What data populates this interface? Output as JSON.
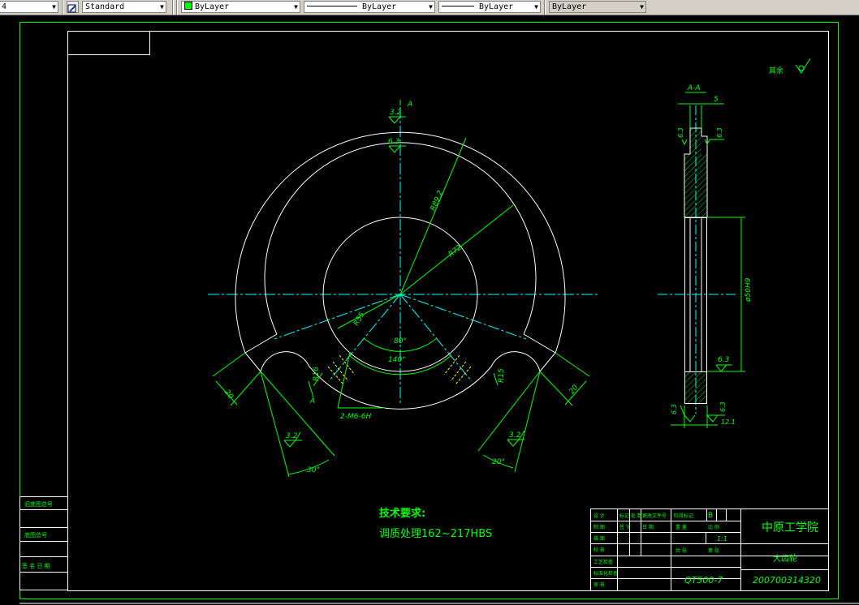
{
  "toolbar": {
    "first_value": "4",
    "text_style": "Standard",
    "color": "ByLayer",
    "color_swatch": "#00ff00",
    "linetype": "ByLayer",
    "lineweight": "ByLayer",
    "plot_style": "ByLayer"
  },
  "colors": {
    "frame": "#00ff00",
    "geometry": "#ffffff",
    "centerline": "#00ffff",
    "dimension": "#00ff00",
    "hatch": "#00ff00",
    "background": "#000000"
  },
  "drawing": {
    "section_label": "A",
    "section_title": "A-A",
    "roughness": {
      "r32": "3.2",
      "r63": "6.3"
    },
    "dims": {
      "radius_outer": "R89.2",
      "radius_mid": "R72",
      "radius_bore": "R55",
      "angle_inner": "80°",
      "angle_outer": "140°",
      "thread_note": "2-M6-6H",
      "notch_r_left": "R16",
      "notch_r_right": "R15",
      "width_left": "20",
      "width_right": "20",
      "angle_left": "30°",
      "angle_right": "20°",
      "section_width": "5",
      "section_diameter": "ø50H9",
      "section_bottom": "12.1"
    },
    "other_surfaces": "其余",
    "tech_req_title": "技术要求:",
    "tech_req_text": "调质处理162~217HBS"
  },
  "side_stamp": {
    "cells": [
      "旧底图总号",
      "底图总号",
      "签 名 日 期"
    ]
  },
  "title_block": {
    "institution": "中原工学院",
    "part_name": "大齿轮",
    "material": "QT500-7",
    "drawing_number": "200700314320",
    "scale": "1:1",
    "stage_mark": "B",
    "rows_left": [
      "设 计",
      "制 图",
      "描 图",
      "校 核",
      "工艺检查",
      "标准化检查",
      "审 核"
    ],
    "rows_mid": [
      "标记",
      "处 数",
      "更改文件号",
      "签 字",
      "日 期"
    ],
    "cells_right": [
      "阶段标记",
      "重 量",
      "比 例",
      "共 张",
      "第 张"
    ]
  }
}
